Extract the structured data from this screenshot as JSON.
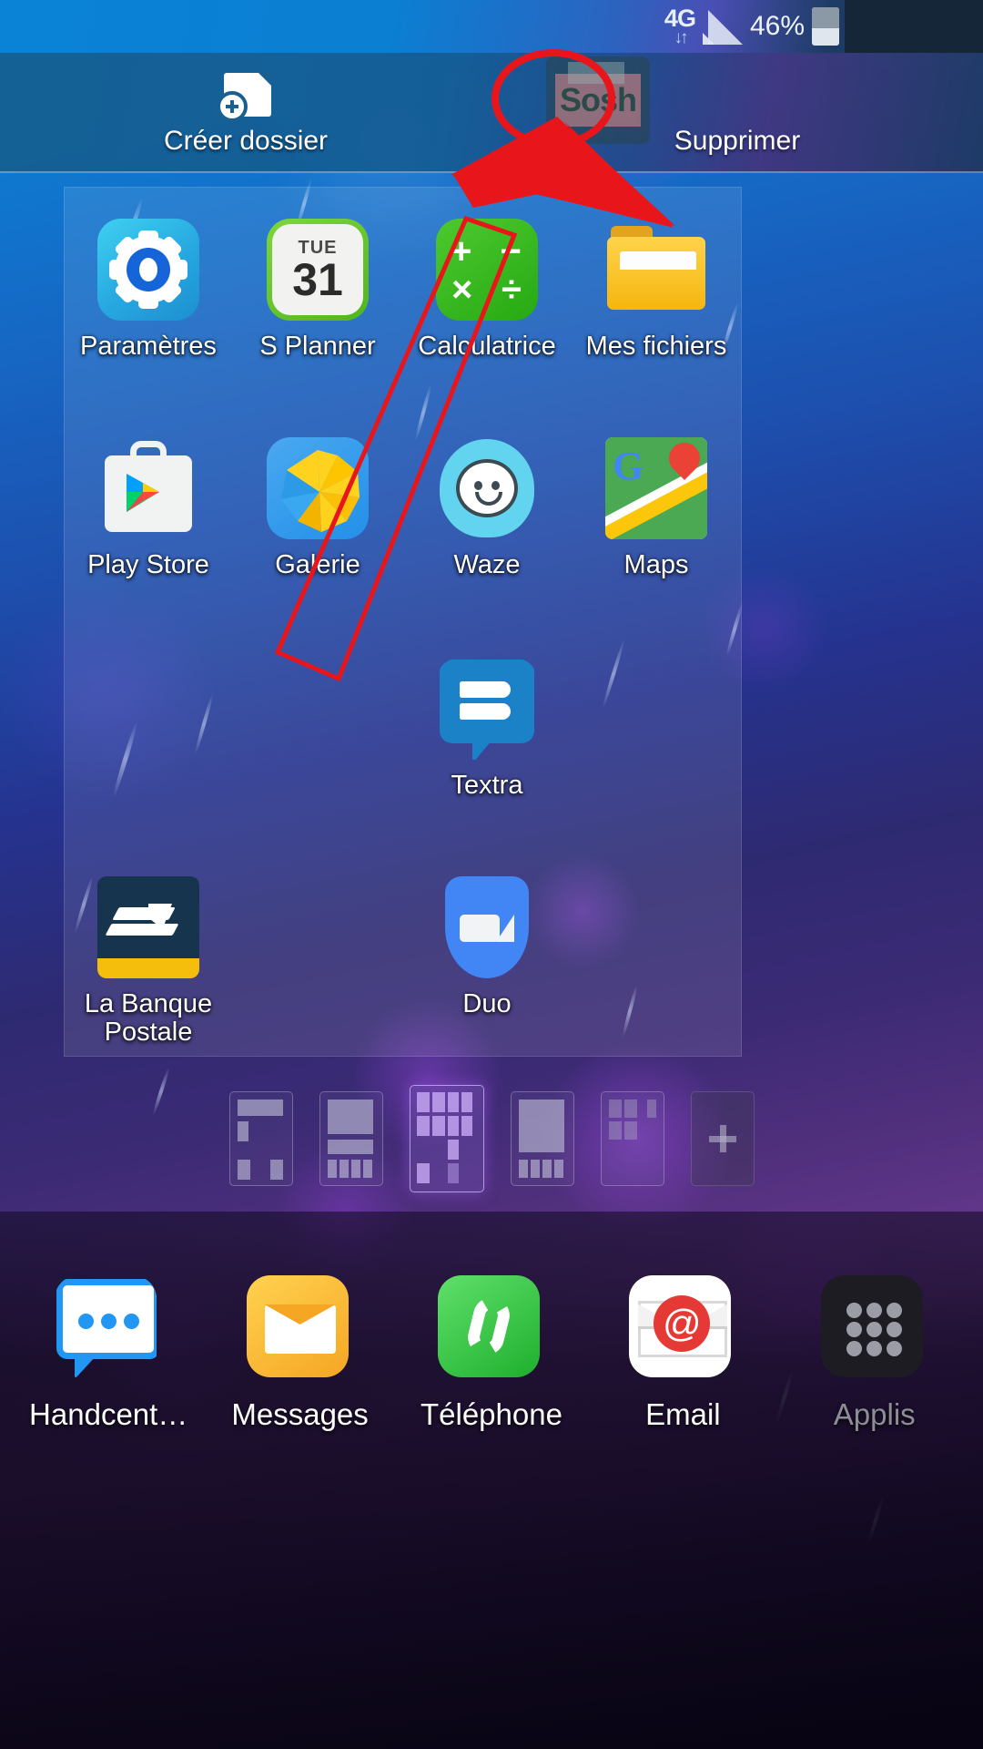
{
  "status_bar": {
    "network": "4G",
    "data_arrows": "↓↑",
    "battery_percent": "46%"
  },
  "drop_bar": {
    "create_folder_label": "Créer dossier",
    "delete_label": "Supprimer",
    "dragged_app_label": "Sosh"
  },
  "home_grid": {
    "apps": [
      {
        "label": "Paramètres",
        "icon": "settings-icon"
      },
      {
        "label": "S Planner",
        "icon": "calendar-icon",
        "day_abbr": "TUE",
        "day_number": "31"
      },
      {
        "label": "Calculatrice",
        "icon": "calculator-icon",
        "symbols": [
          "+",
          "−",
          "×",
          "÷"
        ]
      },
      {
        "label": "Mes fichiers",
        "icon": "folder-icon"
      },
      {
        "label": "Play Store",
        "icon": "play-store-icon"
      },
      {
        "label": "Galerie",
        "icon": "gallery-icon"
      },
      {
        "label": "Waze",
        "icon": "waze-icon"
      },
      {
        "label": "Maps",
        "icon": "maps-icon",
        "glyph": "G"
      },
      {
        "label": "Textra",
        "icon": "textra-icon"
      },
      {
        "label": "La Banque\nPostale",
        "icon": "banque-postale-icon"
      },
      {
        "label": "Duo",
        "icon": "duo-icon"
      }
    ]
  },
  "page_indicator": {
    "count": 6,
    "active_index": 2,
    "add_page_label": "+"
  },
  "dock": {
    "apps": [
      {
        "label": "Handcent…",
        "icon": "handcent-icon"
      },
      {
        "label": "Messages",
        "icon": "messages-icon"
      },
      {
        "label": "Téléphone",
        "icon": "phone-icon"
      },
      {
        "label": "Email",
        "icon": "email-icon",
        "glyph": "@"
      },
      {
        "label": "Applis",
        "icon": "app-drawer-icon",
        "muted": true
      }
    ]
  },
  "annotations": {
    "circle_color": "#e8161b",
    "arrow_color": "#e8161b",
    "description": "red circle around delete target and arrow pointing to it"
  },
  "colors": {
    "accent_red": "#e8161b",
    "status_bar_blue": "#0a82d6",
    "drop_bar_blue": "#155f91"
  }
}
